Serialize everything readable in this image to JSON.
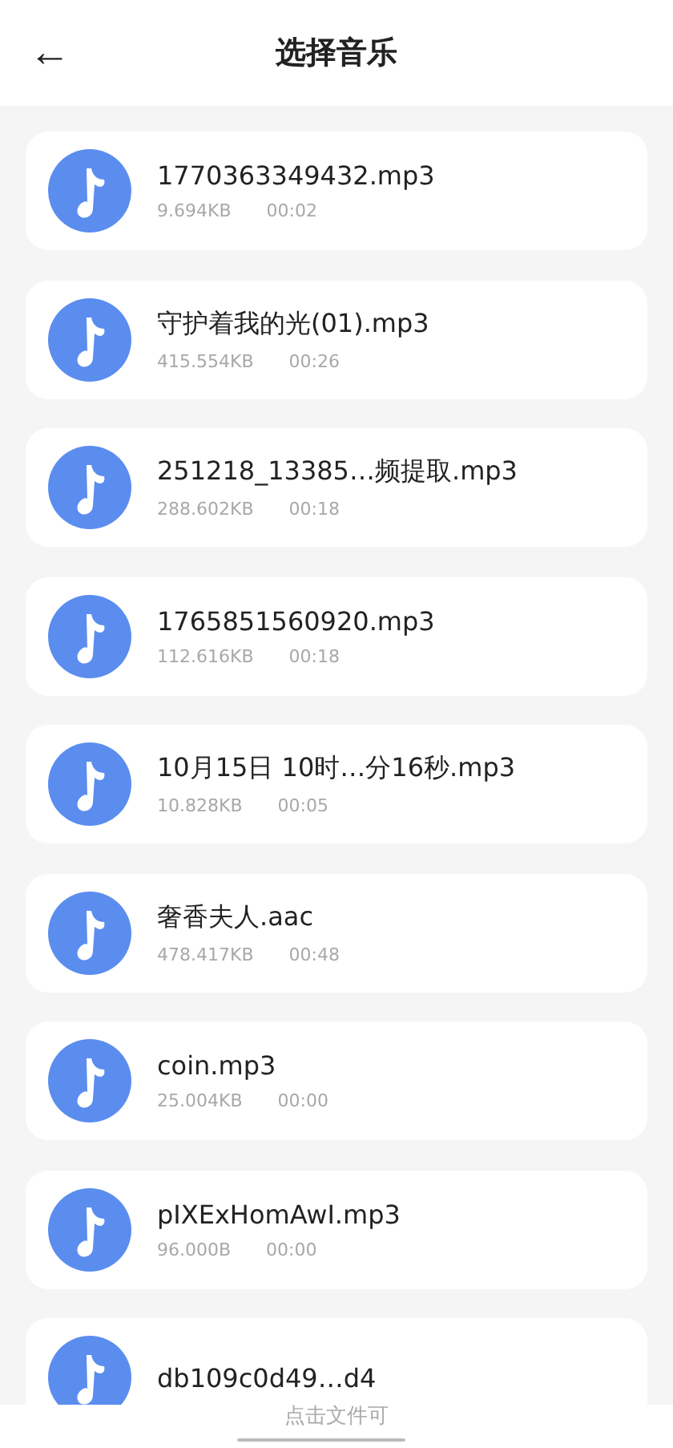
{
  "header": {
    "back": "←",
    "title": "选择音乐"
  },
  "files": [
    {
      "name": "1770363349432.mp3",
      "size": "9.694KB",
      "duration": "00:02"
    },
    {
      "name": "守护着我的光(01).mp3",
      "size": "415.554KB",
      "duration": "00:26"
    },
    {
      "name": "251218_13385…频提取.mp3",
      "size": "288.602KB",
      "duration": "00:18"
    },
    {
      "name": "1765851560920.mp3",
      "size": "112.616KB",
      "duration": "00:18"
    },
    {
      "name": "10月15日 10时…分16秒.mp3",
      "size": "10.828KB",
      "duration": "00:05"
    },
    {
      "name": "奢香夫人.aac",
      "size": "478.417KB",
      "duration": "00:48"
    },
    {
      "name": "coin.mp3",
      "size": "25.004KB",
      "duration": "00:00"
    },
    {
      "name": "pIXExHomAwI.mp3",
      "size": "96.000B",
      "duration": "00:00"
    },
    {
      "name": "db109c0d49…d4"
    }
  ],
  "hint": "点击文件可"
}
